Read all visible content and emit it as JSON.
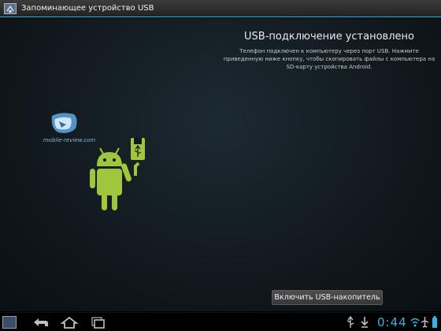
{
  "titlebar": {
    "title": "Запоминающее устройство USB",
    "app_icon": "usb-storage-icon"
  },
  "main": {
    "heading": "USB-подключение установлено",
    "description": "Телефон подключен к компьютеру через порт USB. Нажмите приведенную ниже кнопку, чтобы скопировать файлы с компьютера на SD-карту устройства Android.",
    "button_label": "Включить USB-накопитель",
    "illustration": "android-usb-icon"
  },
  "watermark": {
    "text": "mobile-review.com"
  },
  "navbar": {
    "back_icon": "back-icon",
    "home_icon": "home-icon",
    "recent_icon": "recent-apps-icon",
    "clock": "0:44",
    "accent_color": "#33b5e5"
  },
  "colors": {
    "accent": "#33b5e5",
    "android_green": "#9fc63c"
  }
}
